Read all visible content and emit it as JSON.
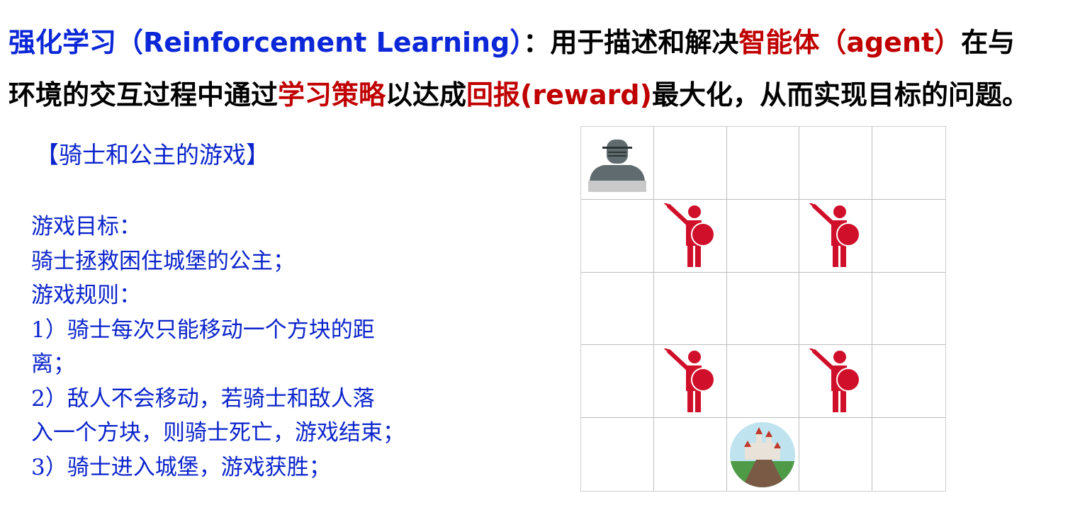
{
  "headline": {
    "line1": {
      "blue": "强化学习（Reinforcement Learning）",
      "black1": "：用于描述和解决",
      "red": "智能体（agent）",
      "black2": "在与"
    },
    "line2": {
      "black1": "环境的交互过程中通过",
      "red1": "学习策略",
      "black2": "以达成",
      "red2": "回报(reward)",
      "black3": "最大化，从而实现目标的问题。"
    }
  },
  "game": {
    "title": "【骑士和公主的游戏】",
    "lines": [
      "游戏目标：",
      "骑士拯救困住城堡的公主；",
      "游戏规则：",
      "1）骑士每次只能移动一个方块的距",
      "离；",
      "2）敌人不会移动，若骑士和敌人落",
      "入一个方块，则骑士死亡，游戏结束；",
      "3）骑士进入城堡，游戏获胜；"
    ]
  },
  "grid": {
    "rows": 5,
    "cols": 5,
    "pieces": [
      {
        "type": "knight",
        "row": 0,
        "col": 0,
        "icon": "knight-icon"
      },
      {
        "type": "enemy",
        "row": 1,
        "col": 1,
        "icon": "enemy-swordsman-icon"
      },
      {
        "type": "enemy",
        "row": 1,
        "col": 3,
        "icon": "enemy-swordsman-icon"
      },
      {
        "type": "enemy",
        "row": 3,
        "col": 1,
        "icon": "enemy-swordsman-icon"
      },
      {
        "type": "enemy",
        "row": 3,
        "col": 3,
        "icon": "enemy-swordsman-icon"
      },
      {
        "type": "castle",
        "row": 4,
        "col": 2,
        "icon": "castle-icon"
      }
    ]
  },
  "colors": {
    "title_blue": "#0b27d8",
    "highlight_red": "#c00000",
    "body_blue": "#0b24cc",
    "enemy_red": "#d0102a",
    "knight_gray": "#5f6b6e"
  }
}
